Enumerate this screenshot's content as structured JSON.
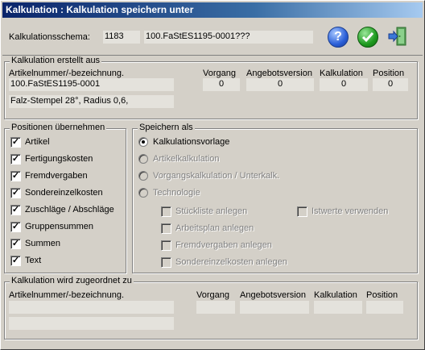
{
  "window": {
    "title": "Kalkulation : Kalkulation speichern unter"
  },
  "header": {
    "schema_label": "Kalkulationsschema:",
    "schema_number": "1183",
    "schema_name": "100.FaStES1195-0001???"
  },
  "created_from": {
    "title": "Kalkulation erstellt aus",
    "article_label": "Artikelnummer/-bezeichnung.",
    "article_value": "100.FaStES1195-0001",
    "article_desc": "Falz-Stempel 28°, Radius 0,6,",
    "col_vorgang": "Vorgang",
    "col_angebot": "Angebotsversion",
    "col_kalkulation": "Kalkulation",
    "col_position": "Position",
    "val_vorgang": "0",
    "val_angebot": "0",
    "val_kalkulation": "0",
    "val_position": "0"
  },
  "positions": {
    "title": "Positionen übernehmen",
    "items": [
      {
        "label": "Artikel",
        "checked": true
      },
      {
        "label": "Fertigungskosten",
        "checked": true
      },
      {
        "label": "Fremdvergaben",
        "checked": true
      },
      {
        "label": "Sondereinzelkosten",
        "checked": true
      },
      {
        "label": "Zuschläge / Abschläge",
        "checked": true
      },
      {
        "label": "Gruppensummen",
        "checked": true
      },
      {
        "label": "Summen",
        "checked": true
      },
      {
        "label": "Text",
        "checked": true
      }
    ]
  },
  "save_as": {
    "title": "Speichern als",
    "options": [
      {
        "label": "Kalkulationsvorlage",
        "selected": true,
        "enabled": true
      },
      {
        "label": "Artikelkalkulation",
        "selected": false,
        "enabled": false
      },
      {
        "label": "Vorgangskalkulation / Unterkalk.",
        "selected": false,
        "enabled": false
      },
      {
        "label": "Technologie",
        "selected": false,
        "enabled": false
      }
    ],
    "sub_options": [
      {
        "label": "Stückliste anlegen",
        "checked": false
      },
      {
        "label": "Arbeitsplan anlegen",
        "checked": false
      },
      {
        "label": "Fremdvergaben anlegen",
        "checked": false
      },
      {
        "label": "Sondereinzelkosten anlegen",
        "checked": false
      }
    ],
    "istwerte_label": "Istwerte verwenden"
  },
  "assigned_to": {
    "title": "Kalkulation wird zugeordnet zu",
    "article_label": "Artikelnummer/-bezeichnung.",
    "col_vorgang": "Vorgang",
    "col_angebot": "Angebotsversion",
    "col_kalkulation": "Kalkulation",
    "col_position": "Position"
  },
  "icons": {
    "help": "help-icon",
    "ok": "ok-check-icon",
    "exit": "exit-door-icon"
  },
  "colors": {
    "title_start": "#0a246a",
    "title_end": "#a6caf0",
    "dialog_bg": "#d4d0c8",
    "field_bg": "#e4e2dc"
  }
}
